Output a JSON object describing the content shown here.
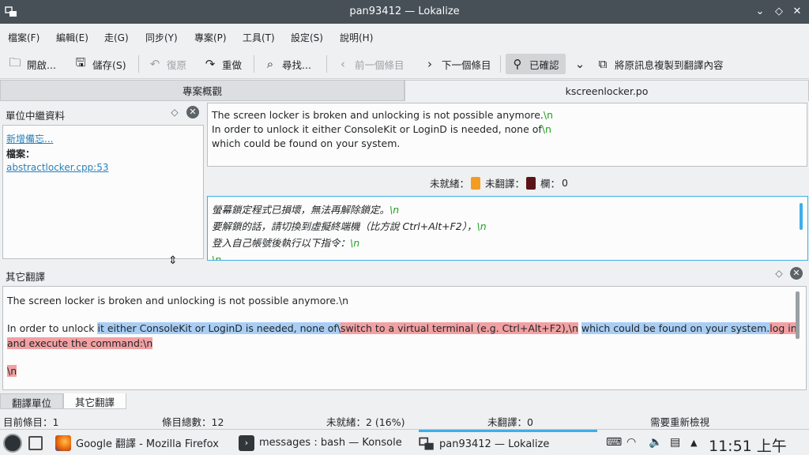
{
  "window": {
    "title": "pan93412 — Lokalize"
  },
  "menu": [
    "檔案(F)",
    "編輯(E)",
    "走(G)",
    "同步(Y)",
    "專案(P)",
    "工具(T)",
    "設定(S)",
    "說明(H)"
  ],
  "toolbar": {
    "open": "開啟...",
    "save": "儲存(S)",
    "undo": "復原",
    "redo": "重做",
    "find": "尋找...",
    "prev": "前一個條目",
    "next": "下一個條目",
    "approved": "已確認",
    "copy_source": "將原訊息複製到翻譯內容"
  },
  "tabs": {
    "project": "專案概觀",
    "file": "kscreenlocker.po"
  },
  "metadata_panel": {
    "title": "單位中繼資料",
    "add_note": "新增備忘...",
    "file_label": "檔案：",
    "file_link": "abstractlocker.cpp:53"
  },
  "source": {
    "l1": "The screen locker is broken and unlocking is not possible anymore.",
    "l2": "In order to unlock it either ConsoleKit or LoginD is needed, none of",
    "l3": "which could be found on your system.",
    "esc": "\\n"
  },
  "counters": {
    "fuzzy_label": "未就緒：",
    "untranslated_label": "未翻譯：",
    "cols_label": "欄：",
    "cols_value": "0"
  },
  "target": {
    "l1": "螢幕鎖定程式已損壞，無法再解除鎖定。",
    "l2": "要解鎖的話，請切換到虛擬終端機（比方說 Ctrl+Alt+F2），",
    "l3": "登入自己帳號後執行以下指令：",
    "esc": "\\n"
  },
  "alt_panel": {
    "title": "其它翻譯",
    "line1": "The screen locker is broken and unlocking is not possible anymore.\\n",
    "line2_a": "In order to unlock ",
    "line2_b": "it either ConsoleKit or LoginD is needed, none of\\",
    "line2_c": "switch to a virtual terminal (e.g. Ctrl+Alt+F2),\\n",
    "line2_d": "which could be found on your system.",
    "line2_e": "log in",
    "line3": "and execute the command:\\n",
    "line4": "\\n"
  },
  "bottom_tabs": {
    "t1": "翻譯單位",
    "t2": "其它翻譯"
  },
  "status": {
    "current": "目前條目：1",
    "total": "條目總數：12",
    "fuzzy": "未就緒：2 (16%)",
    "untranslated": "未翻譯：0",
    "review": "需要重新檢視"
  },
  "taskbar": {
    "firefox": "Google 翻譯 - Mozilla Firefox",
    "konsole": "messages : bash — Konsole",
    "lokalize": "pan93412 — Lokalize",
    "clock": "11:51 上午"
  },
  "colors": {
    "titlebar": "#475057",
    "link": "#2980b9",
    "escape": "#21a021",
    "highlight_blue": "#a8cef5",
    "highlight_red": "#f2a0a2",
    "focus_border": "#3daee9"
  }
}
